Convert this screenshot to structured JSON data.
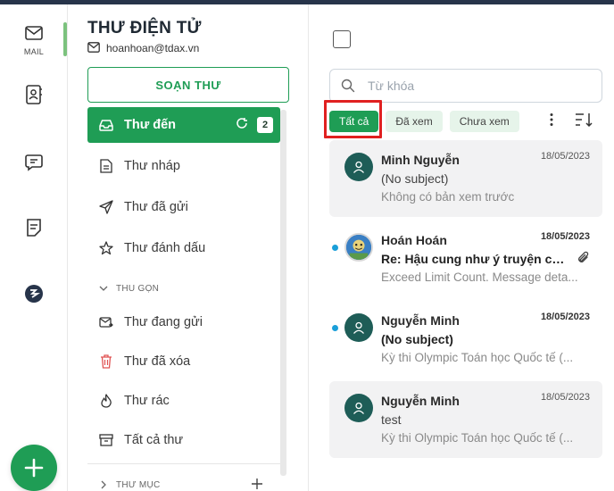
{
  "rail": {
    "mail_label": "MAIL"
  },
  "folders_panel": {
    "title": "THƯ ĐIỆN TỬ",
    "account_email": "hoanhoan@tdax.vn",
    "compose_label": "SOẠN THƯ",
    "items": [
      {
        "label": "Thư đến",
        "icon": "inbox-icon",
        "unread_count": "2",
        "active": true
      },
      {
        "label": "Thư nháp",
        "icon": "draft-icon"
      },
      {
        "label": "Thư đã gửi",
        "icon": "send-icon"
      },
      {
        "label": "Thư đánh dấu",
        "icon": "star-icon"
      }
    ],
    "collapse_label": "THU GỌN",
    "more_items": [
      {
        "label": "Thư đang gửi",
        "icon": "outbox-icon"
      },
      {
        "label": "Thư đã xóa",
        "icon": "trash-icon"
      },
      {
        "label": "Thư rác",
        "icon": "spam-icon"
      },
      {
        "label": "Tất cả thư",
        "icon": "archive-icon"
      }
    ],
    "folders_section_label": "THƯ MỤC"
  },
  "list_panel": {
    "search_placeholder": "Từ khóa",
    "filters": [
      {
        "label": "Tất cả",
        "active": true
      },
      {
        "label": "Đã xem",
        "active": false
      },
      {
        "label": "Chưa xem",
        "active": false
      }
    ],
    "mails": [
      {
        "sender": "Minh Nguyễn",
        "date": "18/05/2023",
        "subject": "(No subject)",
        "preview": "Không có bản xem trước",
        "read": true,
        "has_attachment": false
      },
      {
        "sender": "Hoán Hoán",
        "date": "18/05/2023",
        "subject": "Re: Hậu cung như ý truyện ch...",
        "preview": "Exceed Limit Count. Message deta...",
        "read": false,
        "has_attachment": true
      },
      {
        "sender": "Nguyễn Minh",
        "date": "18/05/2023",
        "subject": "(No subject)",
        "preview": "Kỳ thi Olympic Toán học Quốc tế (...",
        "read": false,
        "has_attachment": false
      },
      {
        "sender": "Nguyễn Minh",
        "date": "18/05/2023",
        "subject": "test",
        "preview": "Kỳ thi Olympic Toán học Quốc tế (...",
        "read": true,
        "has_attachment": false
      }
    ]
  },
  "colors": {
    "accent": "#1f9d55",
    "highlight": "#e02020",
    "unread_dot": "#1a9fd9"
  }
}
